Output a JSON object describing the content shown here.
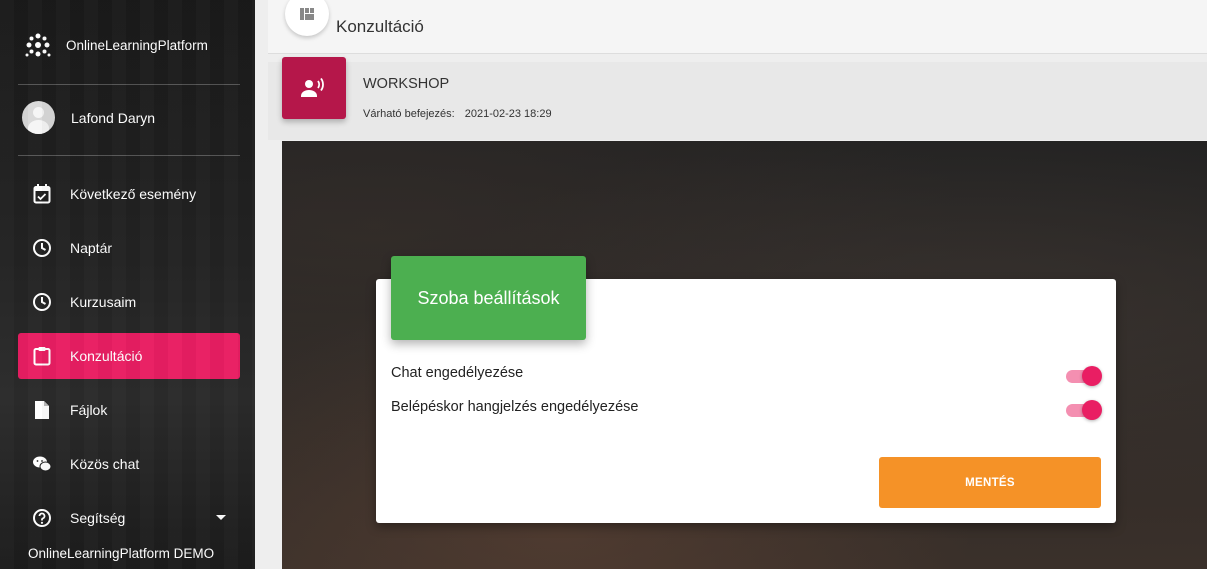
{
  "sidebar": {
    "brand_name": "OnlineLearningPlatform",
    "user_name": "Lafond Daryn",
    "items": [
      {
        "label": "Következő esemény",
        "icon": "calendar-check-icon"
      },
      {
        "label": "Naptár",
        "icon": "clock-icon"
      },
      {
        "label": "Kurzusaim",
        "icon": "clock-icon"
      },
      {
        "label": "Konzultáció",
        "icon": "clipboard-icon",
        "active": true
      },
      {
        "label": "Fájlok",
        "icon": "file-icon"
      },
      {
        "label": "Közös chat",
        "icon": "chat-icon"
      },
      {
        "label": "Segítség",
        "icon": "help-icon"
      }
    ],
    "footer": "OnlineLearningPlatform DEMO"
  },
  "topbar": {
    "title": "Konzultáció",
    "icon": "view-quilt-icon"
  },
  "workshop": {
    "title": "WORKSHOP",
    "due_label": "Várható befejezés:",
    "due_value": "2021-02-23 18:29",
    "icon": "record-voice-icon"
  },
  "dialog": {
    "title": "Szoba beállítások",
    "options": [
      {
        "label": "Chat engedélyezése",
        "enabled": true
      },
      {
        "label": "Belépéskor hangjelzés engedélyezése",
        "enabled": true
      }
    ],
    "save_label": "MENTÉS"
  },
  "colors": {
    "accent": "#e91e63",
    "header_green": "#4caf50",
    "save_orange": "#f59227",
    "workshop_icon_bg": "#b5174a"
  }
}
